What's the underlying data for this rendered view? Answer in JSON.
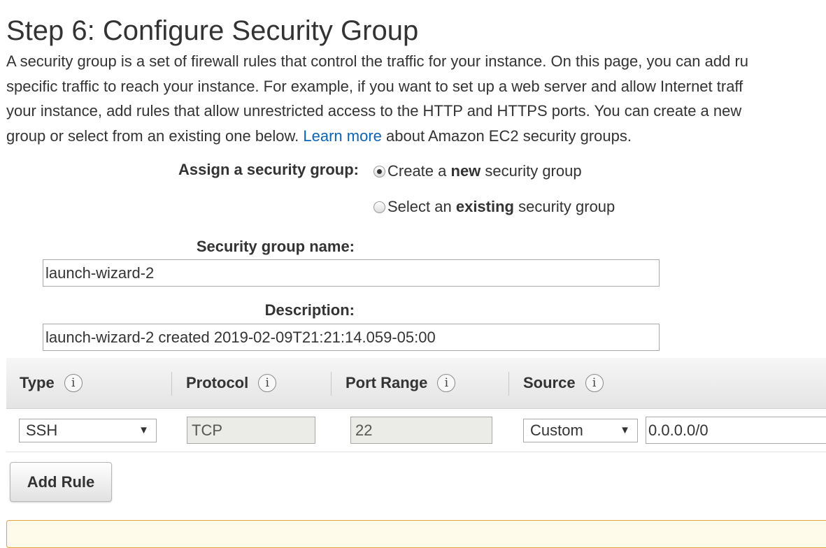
{
  "page": {
    "title": "Step 6: Configure Security Group",
    "intro": {
      "line1": "A security group is a set of firewall rules that control the traffic for your instance. On this page, you can add ru",
      "line2": "specific traffic to reach your instance. For example, if you want to set up a web server and allow Internet traff",
      "line3": "your instance, add rules that allow unrestricted access to the HTTP and HTTPS ports. You can create a new",
      "line4_before": "group or select from an existing one below.",
      "learn_more": "Learn more",
      "line4_after": "about Amazon EC2 security groups."
    }
  },
  "assign": {
    "label": "Assign a security group:",
    "option_new": {
      "pre": "Create a ",
      "bold": "new",
      "post": " security group",
      "checked": true
    },
    "option_existing": {
      "pre": "Select an ",
      "bold": "existing",
      "post": " security group",
      "checked": false
    }
  },
  "form": {
    "name_label": "Security group name:",
    "name_value": "launch-wizard-2",
    "description_label": "Description:",
    "description_value": "launch-wizard-2 created 2019-02-09T21:21:14.059-05:00"
  },
  "rules_table": {
    "headers": {
      "type": "Type",
      "protocol": "Protocol",
      "port_range": "Port Range",
      "source": "Source"
    },
    "info_glyph": "i",
    "rows": [
      {
        "type": "SSH",
        "protocol": "TCP",
        "port_range": "22",
        "source_type": "Custom",
        "source_cidr": "0.0.0.0/0"
      }
    ],
    "dropdown_arrow": "▼"
  },
  "actions": {
    "add_rule": "Add Rule"
  },
  "colors": {
    "link": "#0a64b4",
    "warning_border": "#e0a23c",
    "warning_bg": "#fffbeb"
  }
}
